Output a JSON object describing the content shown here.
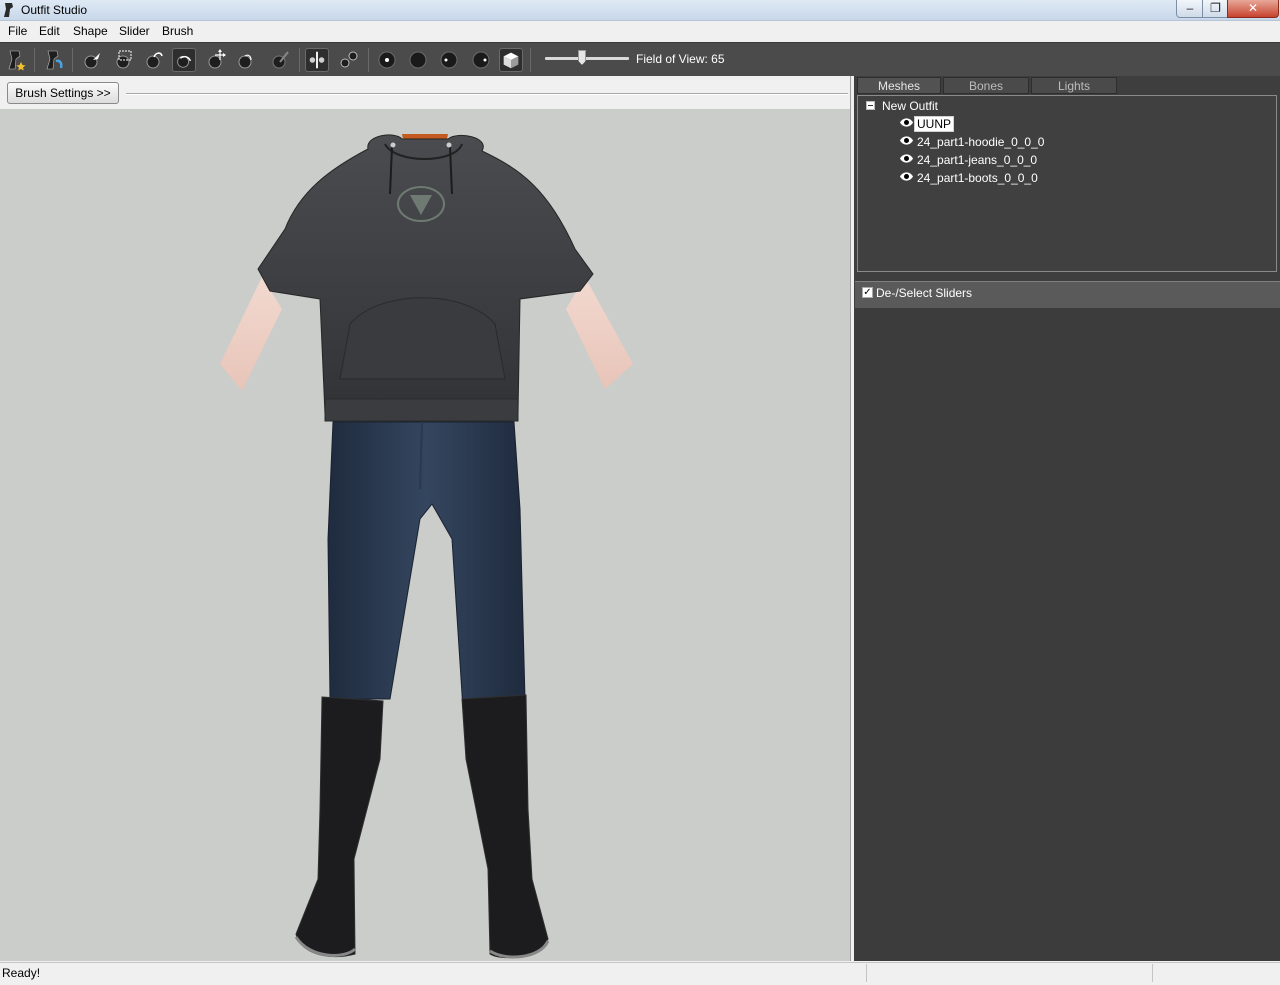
{
  "window": {
    "title": "Outfit Studio",
    "minimize": "–",
    "maximize": "❐",
    "close": "✕"
  },
  "menu": [
    "File",
    "Edit",
    "Shape",
    "Slider",
    "Brush"
  ],
  "toolbar": {
    "field_of_view_label": "Field of View: 65",
    "field_of_view_value": 65
  },
  "brush_settings_button": "Brush Settings >>",
  "tabs": [
    "Meshes",
    "Bones",
    "Lights"
  ],
  "active_tab": "Meshes",
  "mesh_tree": {
    "root": "New Outfit",
    "items": [
      "UUNP",
      "24_part1-hoodie_0_0_0",
      "24_part1-jeans_0_0_0",
      "24_part1-boots_0_0_0"
    ],
    "selected": "UUNP"
  },
  "sliders": {
    "toggle_label": "De-/Select Sliders",
    "checked": true
  },
  "status": {
    "text": "Ready!"
  }
}
